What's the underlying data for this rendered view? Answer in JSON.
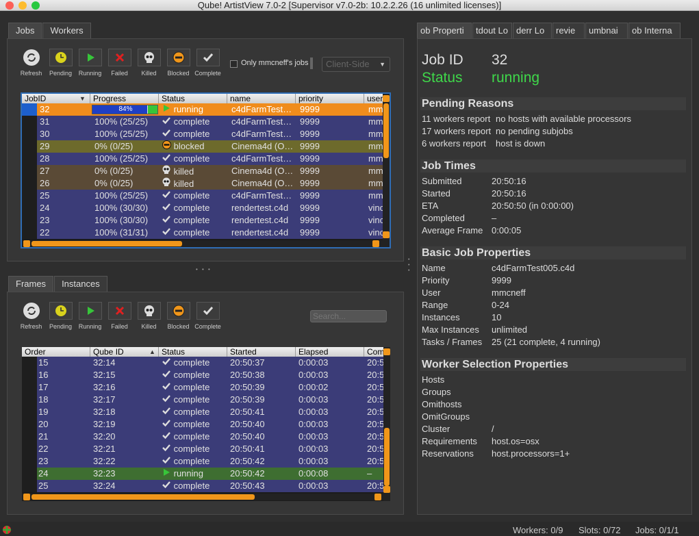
{
  "window": {
    "title": "Qube! ArtistView 7.0-2 [Supervisor v7.0-2b: 10.2.2.26 (16 unlimited licenses)]"
  },
  "jobs_tabs": [
    "Jobs",
    "Workers"
  ],
  "frames_tabs": [
    "Frames",
    "Instances"
  ],
  "right_tabs": [
    "ob Properti",
    "tdout Lo",
    "derr Lo",
    "revie",
    "umbnai",
    "ob Interna"
  ],
  "toolbar": {
    "refresh": "Refresh",
    "pending": "Pending",
    "running": "Running",
    "failed": "Failed",
    "killed": "Killed",
    "blocked": "Blocked",
    "complete": "Complete"
  },
  "filter": {
    "only_mine": "Only mmcneff's jobs",
    "client_side": "Client-Side",
    "search_placeholder": "Search..."
  },
  "jobs_table": {
    "columns": [
      "JobID",
      "Progress",
      "Status",
      "name",
      "priority",
      "user"
    ],
    "rows": [
      {
        "id": "32",
        "progress": "84%",
        "status": "running",
        "name": "c4dFarmTest…",
        "priority": "9999",
        "user": "mm"
      },
      {
        "id": "31",
        "progress": "100% (25/25)",
        "status": "complete",
        "name": "c4dFarmTest…",
        "priority": "9999",
        "user": "mm"
      },
      {
        "id": "30",
        "progress": "100% (25/25)",
        "status": "complete",
        "name": "c4dFarmTest…",
        "priority": "9999",
        "user": "mm"
      },
      {
        "id": "29",
        "progress": "0% (0/25)",
        "status": "blocked",
        "name": "Cinema4d (O…",
        "priority": "9999",
        "user": "mm"
      },
      {
        "id": "28",
        "progress": "100% (25/25)",
        "status": "complete",
        "name": "c4dFarmTest…",
        "priority": "9999",
        "user": "mm"
      },
      {
        "id": "27",
        "progress": "0% (0/25)",
        "status": "killed",
        "name": "Cinema4d (O…",
        "priority": "9999",
        "user": "mm"
      },
      {
        "id": "26",
        "progress": "0% (0/25)",
        "status": "killed",
        "name": "Cinema4d (O…",
        "priority": "9999",
        "user": "mm"
      },
      {
        "id": "25",
        "progress": "100% (25/25)",
        "status": "complete",
        "name": "c4dFarmTest…",
        "priority": "9999",
        "user": "mm"
      },
      {
        "id": "24",
        "progress": "100% (30/30)",
        "status": "complete",
        "name": "rendertest.c4d",
        "priority": "9999",
        "user": "vinc"
      },
      {
        "id": "23",
        "progress": "100% (30/30)",
        "status": "complete",
        "name": "rendertest.c4d",
        "priority": "9999",
        "user": "vinc"
      },
      {
        "id": "22",
        "progress": "100% (31/31)",
        "status": "complete",
        "name": "rendertest.c4d",
        "priority": "9999",
        "user": "vinc"
      }
    ]
  },
  "frames_table": {
    "columns": [
      "Order",
      "Qube ID",
      "Status",
      "Started",
      "Elapsed",
      "Com"
    ],
    "rows": [
      {
        "order": "15",
        "qid": "32:14",
        "status": "complete",
        "started": "20:50:37",
        "elapsed": "0:00:03",
        "com": "20:5"
      },
      {
        "order": "16",
        "qid": "32:15",
        "status": "complete",
        "started": "20:50:38",
        "elapsed": "0:00:03",
        "com": "20:5"
      },
      {
        "order": "17",
        "qid": "32:16",
        "status": "complete",
        "started": "20:50:39",
        "elapsed": "0:00:02",
        "com": "20:5"
      },
      {
        "order": "18",
        "qid": "32:17",
        "status": "complete",
        "started": "20:50:39",
        "elapsed": "0:00:03",
        "com": "20:5"
      },
      {
        "order": "19",
        "qid": "32:18",
        "status": "complete",
        "started": "20:50:41",
        "elapsed": "0:00:03",
        "com": "20:5"
      },
      {
        "order": "20",
        "qid": "32:19",
        "status": "complete",
        "started": "20:50:40",
        "elapsed": "0:00:03",
        "com": "20:5"
      },
      {
        "order": "21",
        "qid": "32:20",
        "status": "complete",
        "started": "20:50:40",
        "elapsed": "0:00:03",
        "com": "20:5"
      },
      {
        "order": "22",
        "qid": "32:21",
        "status": "complete",
        "started": "20:50:41",
        "elapsed": "0:00:03",
        "com": "20:5"
      },
      {
        "order": "23",
        "qid": "32:22",
        "status": "complete",
        "started": "20:50:42",
        "elapsed": "0:00:03",
        "com": "20:5"
      },
      {
        "order": "24",
        "qid": "32:23",
        "status": "running",
        "started": "20:50:42",
        "elapsed": "0:00:08",
        "com": "–"
      },
      {
        "order": "25",
        "qid": "32:24",
        "status": "complete",
        "started": "20:50:43",
        "elapsed": "0:00:03",
        "com": "20:5"
      }
    ]
  },
  "job_props": {
    "job_id_label": "Job ID",
    "job_id": "32",
    "status_label": "Status",
    "status": "running",
    "pending_title": "Pending Reasons",
    "pending": [
      {
        "k": "11 workers report",
        "v": "no hosts with available processors"
      },
      {
        "k": "17 workers report",
        "v": "no pending subjobs"
      },
      {
        "k": "6 workers report",
        "v": "host is down"
      }
    ],
    "times_title": "Job Times",
    "times": [
      {
        "k": "Submitted",
        "v": "20:50:16"
      },
      {
        "k": "Started",
        "v": "20:50:16"
      },
      {
        "k": "ETA",
        "v": "20:50:50 (in 0:00:00)"
      },
      {
        "k": "Completed",
        "v": "–"
      },
      {
        "k": "Average Frame",
        "v": "0:00:05"
      }
    ],
    "basic_title": "Basic Job Properties",
    "basic": [
      {
        "k": "Name",
        "v": "c4dFarmTest005.c4d"
      },
      {
        "k": "Priority",
        "v": "9999"
      },
      {
        "k": "User",
        "v": "mmcneff"
      },
      {
        "k": "Range",
        "v": "0-24"
      },
      {
        "k": "Instances",
        "v": "10"
      },
      {
        "k": "Max Instances",
        "v": "unlimited"
      },
      {
        "k": "Tasks / Frames",
        "v": "25 (21 complete, 4 running)"
      }
    ],
    "worker_title": "Worker Selection Properties",
    "worker": [
      {
        "k": "Hosts",
        "v": ""
      },
      {
        "k": "Groups",
        "v": ""
      },
      {
        "k": "Omithosts",
        "v": ""
      },
      {
        "k": "OmitGroups",
        "v": ""
      },
      {
        "k": "Cluster",
        "v": "/"
      },
      {
        "k": "Requirements",
        "v": "host.os=osx"
      },
      {
        "k": "Reservations",
        "v": "host.processors=1+"
      }
    ]
  },
  "status_bar": {
    "workers": "Workers: 0/9",
    "slots": "Slots: 0/72",
    "jobs": "Jobs: 0/1/1"
  },
  "colors": {
    "row_blue": "#3b3c78",
    "row_orange": "#f08c1c",
    "row_olive": "#6d6a2c",
    "row_brown": "#5a4a36",
    "row_green": "#3e6e31",
    "accent": "#f0961a",
    "status_green": "#3fd84a"
  },
  "progress": {
    "job32_fraction": 0.84
  }
}
